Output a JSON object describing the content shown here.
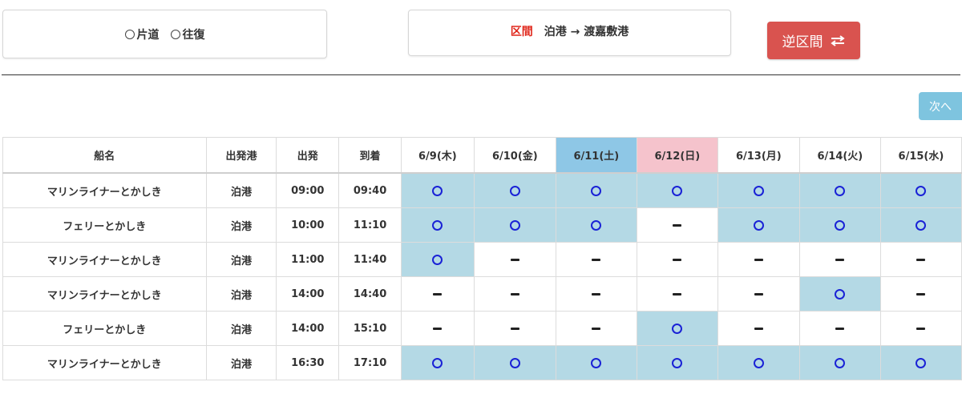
{
  "trip_type": {
    "options": [
      "片道",
      "往復"
    ]
  },
  "route": {
    "label": "区間",
    "value": "泊港 → 渡嘉敷港"
  },
  "reverse_button": {
    "label": "逆区間",
    "icon": "swap-arrows-icon"
  },
  "next_button": {
    "label": "次へ"
  },
  "table": {
    "headers": {
      "ship": "船名",
      "port": "出発港",
      "depart": "出発",
      "arrive": "到着"
    },
    "dates": [
      "6/9(木)",
      "6/10(金)",
      "6/11(土)",
      "6/12(日)",
      "6/13(月)",
      "6/14(火)",
      "6/15(水)"
    ],
    "rows": [
      {
        "ship": "マリンライナーとかしき",
        "port": "泊港",
        "depart": "09:00",
        "arrive": "09:40",
        "avail": [
          "○",
          "○",
          "○",
          "○",
          "○",
          "○",
          "○"
        ]
      },
      {
        "ship": "フェリーとかしき",
        "port": "泊港",
        "depart": "10:00",
        "arrive": "11:10",
        "avail": [
          "○",
          "○",
          "○",
          "−",
          "○",
          "○",
          "○"
        ]
      },
      {
        "ship": "マリンライナーとかしき",
        "port": "泊港",
        "depart": "11:00",
        "arrive": "11:40",
        "avail": [
          "○",
          "−",
          "−",
          "−",
          "−",
          "−",
          "−"
        ]
      },
      {
        "ship": "マリンライナーとかしき",
        "port": "泊港",
        "depart": "14:00",
        "arrive": "14:40",
        "avail": [
          "−",
          "−",
          "−",
          "−",
          "−",
          "○",
          "−"
        ]
      },
      {
        "ship": "フェリーとかしき",
        "port": "泊港",
        "depart": "14:00",
        "arrive": "15:10",
        "avail": [
          "−",
          "−",
          "−",
          "○",
          "−",
          "−",
          "−"
        ]
      },
      {
        "ship": "マリンライナーとかしき",
        "port": "泊港",
        "depart": "16:30",
        "arrive": "17:10",
        "avail": [
          "○",
          "○",
          "○",
          "○",
          "○",
          "○",
          "○"
        ]
      }
    ]
  },
  "colors": {
    "available": "#b4d9e5",
    "today_header": "#8ec7e6",
    "sunday_header": "#f5c3cc",
    "reverse_button": "#d9534f",
    "next_button": "#7ec4df",
    "route_label": "#e0281c"
  }
}
